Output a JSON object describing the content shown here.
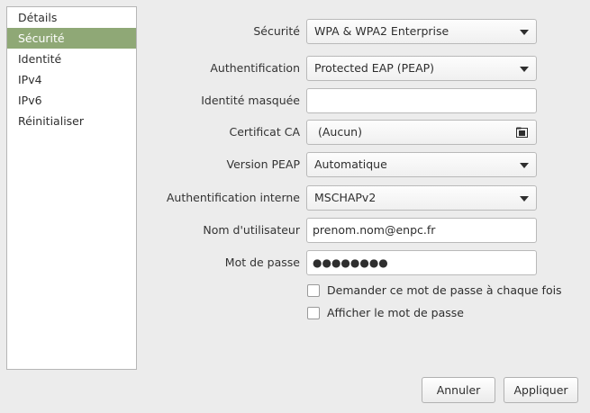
{
  "sidebar": {
    "items": [
      {
        "label": "Détails"
      },
      {
        "label": "Sécurité",
        "active": true
      },
      {
        "label": "Identité"
      },
      {
        "label": "IPv4"
      },
      {
        "label": "IPv6"
      },
      {
        "label": "Réinitialiser"
      }
    ]
  },
  "form": {
    "security": {
      "label": "Sécurité",
      "value": "WPA & WPA2 Enterprise"
    },
    "authentication": {
      "label": "Authentification",
      "value": "Protected EAP (PEAP)"
    },
    "anonymous_identity": {
      "label": "Identité masquée",
      "value": ""
    },
    "ca_certificate": {
      "label": "Certificat CA",
      "value": "(Aucun)"
    },
    "peap_version": {
      "label": "Version PEAP",
      "value": "Automatique"
    },
    "inner_authentication": {
      "label": "Authentification interne",
      "value": "MSCHAPv2"
    },
    "username": {
      "label": "Nom d'utilisateur",
      "value": "prenom.nom@enpc.fr"
    },
    "password": {
      "label": "Mot de passe",
      "masked_value": "●●●●●●●●"
    },
    "ask_password": {
      "label": "Demander ce mot de passe à chaque fois",
      "checked": false
    },
    "show_password": {
      "label": "Afficher le mot de passe",
      "checked": false
    }
  },
  "buttons": {
    "cancel": "Annuler",
    "apply": "Appliquer"
  },
  "colors": {
    "window_bg": "#ececec",
    "sidebar_active": "#8fa876"
  },
  "icons": {
    "dropdown": "arrow-down-icon",
    "file_chooser": "folder-icon"
  }
}
